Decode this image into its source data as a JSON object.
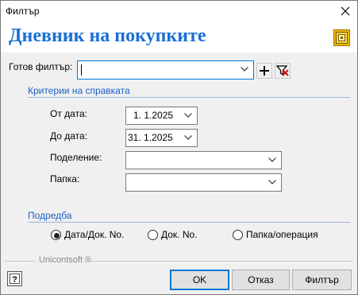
{
  "window": {
    "title": "Филтър"
  },
  "banner": {
    "heading": "Дневник на покупките"
  },
  "ready_filter": {
    "label": "Готов филтър:",
    "value": ""
  },
  "criteria": {
    "title": "Критерии на справката",
    "from_date": {
      "label": "От дата:",
      "value": "1.  1.2025"
    },
    "to_date": {
      "label": "До дата:",
      "value": "31.  1.2025"
    },
    "division": {
      "label": "Поделение:",
      "value": ""
    },
    "folder": {
      "label": "Папка:",
      "value": ""
    }
  },
  "sort": {
    "title": "Подредба",
    "options": [
      {
        "label": "Дата/Док. No.",
        "selected": true
      },
      {
        "label": "Док. No.",
        "selected": false
      },
      {
        "label": "Папка/операция",
        "selected": false
      }
    ]
  },
  "footer": {
    "brand": "Unicontsoft ®"
  },
  "buttons": {
    "ok": "OK",
    "cancel": "Отказ",
    "filter": "Филтър"
  },
  "colors": {
    "heading": "#1a6fd6",
    "group_title": "#1a5fc8",
    "default_border": "#0078d7"
  },
  "icons": [
    "close-icon",
    "app-logo-icon",
    "plus-icon",
    "clear-filter-icon",
    "chevron-down-icon",
    "help-icon"
  ]
}
